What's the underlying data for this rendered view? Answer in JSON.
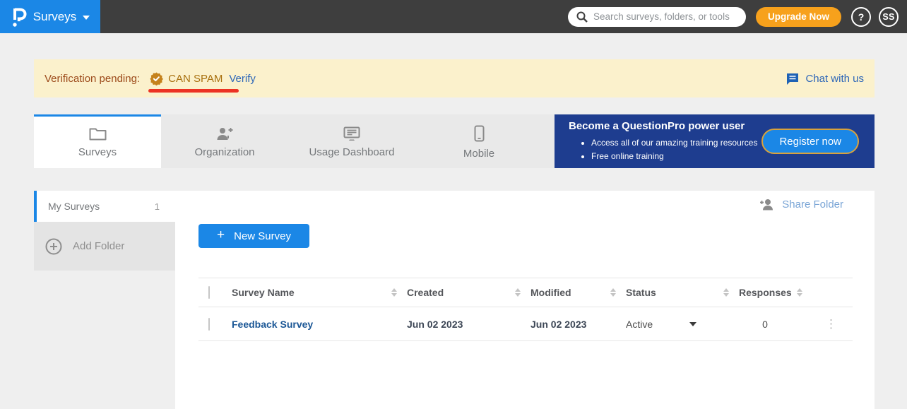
{
  "topbar": {
    "app_label": "Surveys",
    "search_placeholder": "Search surveys, folders, or tools",
    "upgrade_label": "Upgrade Now",
    "help_label": "?",
    "avatar_initials": "SS"
  },
  "banner": {
    "prefix": "Verification pending:",
    "badge_label": "CAN SPAM",
    "verify_label": "Verify",
    "chat_label": "Chat with us"
  },
  "tabs": [
    {
      "label": "Surveys",
      "icon": "folder-icon",
      "active": true
    },
    {
      "label": "Organization",
      "icon": "person-add-icon",
      "active": false
    },
    {
      "label": "Usage Dashboard",
      "icon": "dashboard-icon",
      "active": false
    },
    {
      "label": "Mobile",
      "icon": "mobile-icon",
      "active": false
    }
  ],
  "promo": {
    "title": "Become a QuestionPro power user",
    "bullets": [
      "Access all of our amazing training resources",
      "Free online training"
    ],
    "cta_label": "Register now"
  },
  "sidebar": {
    "my_surveys_label": "My Surveys",
    "my_surveys_count": "1",
    "add_folder_label": "Add Folder"
  },
  "toolbar": {
    "new_survey_label": "New Survey",
    "share_folder_label": "Share Folder"
  },
  "table": {
    "columns": [
      "Survey Name",
      "Created",
      "Modified",
      "Status",
      "Responses"
    ],
    "rows": [
      {
        "name": "Feedback Survey",
        "created": "Jun 02 2023",
        "modified": "Jun 02 2023",
        "status": "Active",
        "responses": "0"
      }
    ]
  },
  "icons": {
    "logo": "questionpro-logo",
    "search": "search-icon",
    "badge": "verified-seal-icon",
    "chat": "chat-bubble-icon",
    "add_folder": "circle-plus-icon",
    "share": "person-add-icon",
    "row_menu": "kebab-menu-icon"
  },
  "colors": {
    "brand_blue": "#1B87E6",
    "topbar_dark": "#3E3E3E",
    "orange": "#F7A11C",
    "navy": "#1E3D8F",
    "banner_bg": "#FBF1CC",
    "banner_text": "#9C4A1A",
    "badge_amber": "#C5821B",
    "link_blue": "#2C66B8",
    "red_underline": "#EC3323",
    "survey_link": "#1B5796"
  }
}
